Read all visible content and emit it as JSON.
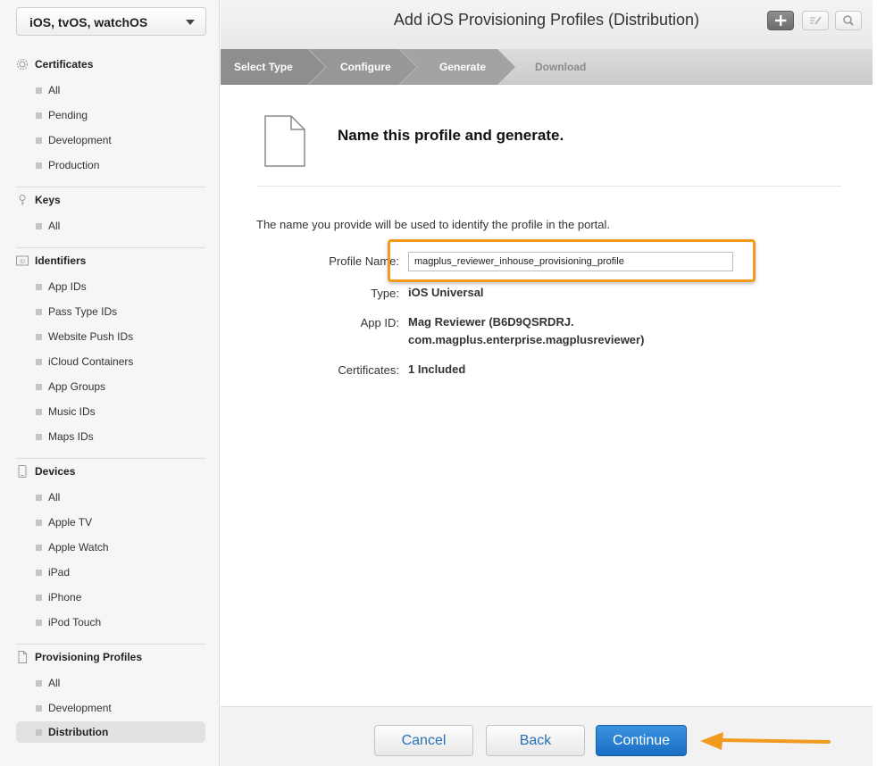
{
  "platform": {
    "selected": "iOS, tvOS, watchOS"
  },
  "sidebar": {
    "sections": [
      {
        "title": "Certificates",
        "icon": "certificate-icon",
        "items": [
          "All",
          "Pending",
          "Development",
          "Production"
        ]
      },
      {
        "title": "Keys",
        "icon": "key-icon",
        "items": [
          "All"
        ]
      },
      {
        "title": "Identifiers",
        "icon": "id-icon",
        "items": [
          "App IDs",
          "Pass Type IDs",
          "Website Push IDs",
          "iCloud Containers",
          "App Groups",
          "Music IDs",
          "Maps IDs"
        ]
      },
      {
        "title": "Devices",
        "icon": "device-icon",
        "items": [
          "All",
          "Apple TV",
          "Apple Watch",
          "iPad",
          "iPhone",
          "iPod Touch"
        ]
      },
      {
        "title": "Provisioning Profiles",
        "icon": "document-icon",
        "items": [
          "All",
          "Development",
          "Distribution"
        ]
      }
    ],
    "active_item": "Distribution"
  },
  "header": {
    "title": "Add iOS Provisioning Profiles (Distribution)",
    "buttons": [
      "add-icon",
      "edit-icon",
      "search-icon"
    ]
  },
  "steps": [
    {
      "label": "Select Type",
      "state": "done"
    },
    {
      "label": "Configure",
      "state": "done"
    },
    {
      "label": "Generate",
      "state": "current"
    },
    {
      "label": "Download",
      "state": "upcoming"
    }
  ],
  "main": {
    "heading": "Name this profile and generate.",
    "description": "The name you provide will be used to identify the profile in the portal.",
    "fields": {
      "profile_name_label": "Profile Name:",
      "profile_name_value": "magplus_reviewer_inhouse_provisioning_profile",
      "type_label": "Type:",
      "type_value": "iOS Universal",
      "app_id_label": "App ID:",
      "app_id_line1": "Mag Reviewer (B6D9QSRDRJ.",
      "app_id_line2": "com.magplus.enterprise.magplusreviewer)",
      "certificates_label": "Certificates:",
      "certificates_value": "1 Included"
    }
  },
  "footer": {
    "cancel": "Cancel",
    "back": "Back",
    "continue": "Continue"
  },
  "colors": {
    "accent": "#1b6ec4",
    "highlight": "#f29a1f",
    "step_done": "#8e8e8e",
    "step_current": "#a3a3a3"
  }
}
